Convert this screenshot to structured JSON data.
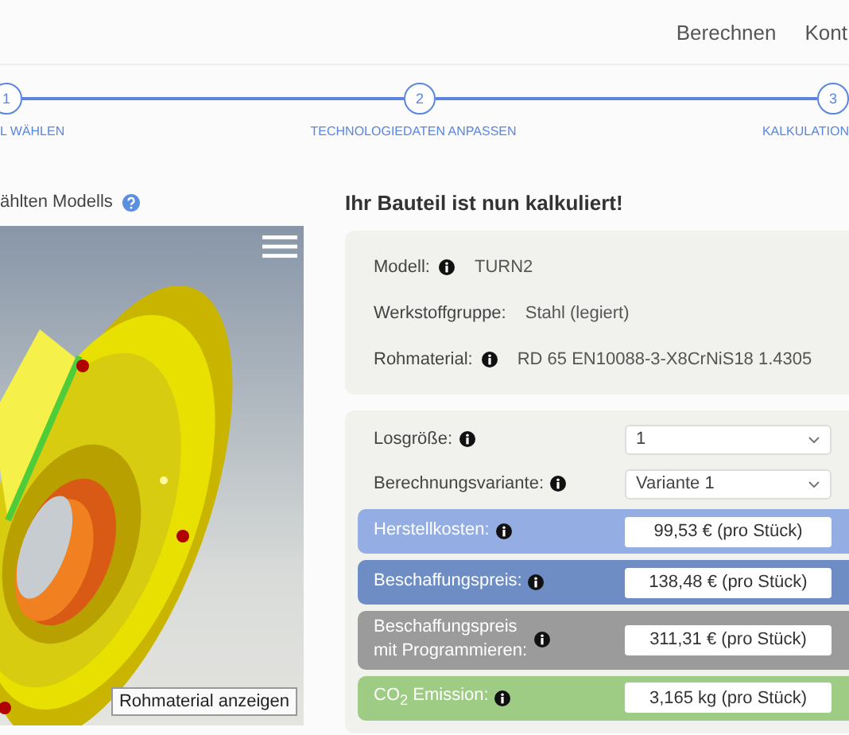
{
  "nav": {
    "items": [
      "Berechnen",
      "Kont"
    ]
  },
  "steps": [
    {
      "number": "1",
      "label": "L WÄHLEN"
    },
    {
      "number": "2",
      "label": "TECHNOLOGIEDATEN ANPASSEN"
    },
    {
      "number": "3",
      "label": "KALKULATION"
    }
  ],
  "viewer": {
    "title": "ählten Modells",
    "button": "Rohmaterial anzeigen"
  },
  "result": {
    "title": "Ihr Bauteil ist nun kalkuliert!",
    "info": [
      {
        "label": "Modell:",
        "info": true,
        "value": "TURN2"
      },
      {
        "label": "Werkstoffgruppe:",
        "info": false,
        "value": "Stahl (legiert)"
      },
      {
        "label": "Rohmaterial:",
        "info": true,
        "value": "RD 65 EN10088-3-X8CrNiS18 1.4305"
      }
    ],
    "selects": [
      {
        "label": "Losgröße:",
        "value": "1"
      },
      {
        "label": "Berechnungsvariante:",
        "value": "Variante 1"
      }
    ],
    "costs": [
      {
        "label": "Herstellkosten:",
        "value": "99,53 € (pro Stück)",
        "color": "#94ade3"
      },
      {
        "label": "Beschaffungspreis:",
        "value": "138,48 € (pro Stück)",
        "color": "#6d8dc4"
      },
      {
        "label": "Beschaffungspreis\nmit Programmieren:",
        "value": "311,31 € (pro Stück)",
        "color": "#9b9b9b"
      },
      {
        "label": "CO$_{2}$ Emission:",
        "value": "3,165 kg (pro Stück)",
        "color": "#9fcc84"
      }
    ]
  }
}
